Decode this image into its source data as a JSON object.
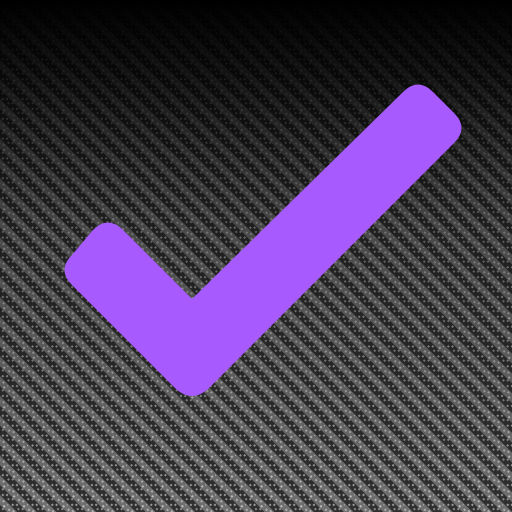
{
  "icon": {
    "symbol": "checkmark-icon",
    "check_color": "#A75BFF",
    "background_base": "#000000",
    "pattern": {
      "style": "diagonal-binary-weave",
      "light_color": "#8E8E8E",
      "dark_color": "#2B2B2B"
    }
  }
}
